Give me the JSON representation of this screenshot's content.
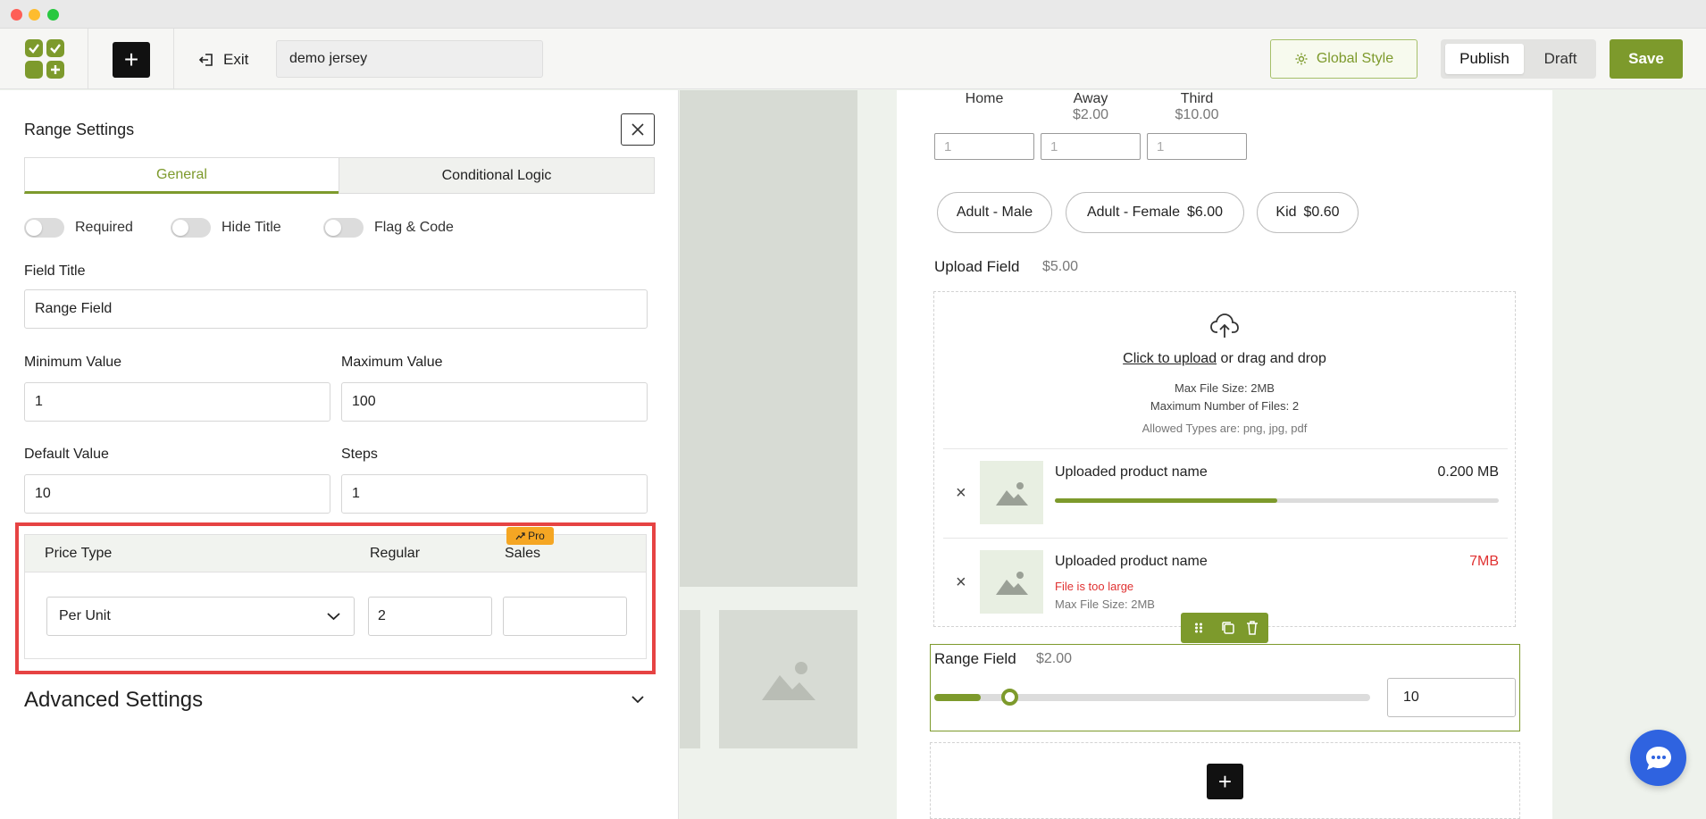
{
  "toolbar": {
    "exit_label": "Exit",
    "form_name": "demo jersey",
    "global_style_label": "Global Style",
    "publish_label": "Publish",
    "draft_label": "Draft",
    "save_label": "Save"
  },
  "panel": {
    "title": "Range Settings",
    "tabs": [
      {
        "label": "General",
        "active": true
      },
      {
        "label": "Conditional Logic",
        "active": false
      }
    ],
    "toggles": [
      {
        "label": "Required",
        "on": false
      },
      {
        "label": "Hide Title",
        "on": false
      },
      {
        "label": "Flag & Code",
        "on": false
      }
    ],
    "field_title_label": "Field Title",
    "field_title_value": "Range Field",
    "min_label": "Minimum Value",
    "min_value": "1",
    "max_label": "Maximum Value",
    "max_value": "100",
    "default_label": "Default Value",
    "default_value": "10",
    "steps_label": "Steps",
    "steps_value": "1",
    "price": {
      "type_header": "Price Type",
      "regular_header": "Regular",
      "sales_header": "Sales",
      "pro_badge": "Pro",
      "type_value": "Per Unit",
      "regular_value": "2",
      "sales_value": ""
    },
    "advanced_label": "Advanced Settings"
  },
  "form": {
    "tickets": [
      {
        "label": "Home",
        "price": "",
        "value": "1"
      },
      {
        "label": "Away",
        "price": "$2.00",
        "value": "1"
      },
      {
        "label": "Third",
        "price": "$10.00",
        "value": "1"
      }
    ],
    "chips": [
      {
        "label": "Adult - Male",
        "price": ""
      },
      {
        "label": "Adult - Female",
        "price": "$6.00"
      },
      {
        "label": "Kid",
        "price": "$0.60"
      }
    ],
    "upload": {
      "title": "Upload Field",
      "price": "$5.00",
      "click_text": "Click to upload",
      "drag_text": "or drag and drop",
      "max_size": "Max File Size: 2MB",
      "max_files": "Maximum Number of Files: 2",
      "allowed": "Allowed Types are: png, jpg, pdf",
      "files": [
        {
          "name": "Uploaded product name",
          "size": "0.200 MB",
          "progress": 0.5,
          "error": "",
          "note": ""
        },
        {
          "name": "Uploaded product name",
          "size": "7MB",
          "progress": null,
          "error": "File is too large",
          "note": "Max File Size: 2MB"
        }
      ]
    },
    "range": {
      "title": "Range Field",
      "price": "$2.00",
      "value": "10",
      "min": 1,
      "max": 100
    }
  },
  "colors": {
    "accent": "#7d9a2c",
    "highlight": "#e64343",
    "pro_badge": "#f5a623",
    "error": "#e03131",
    "chat": "#2f63e0"
  }
}
